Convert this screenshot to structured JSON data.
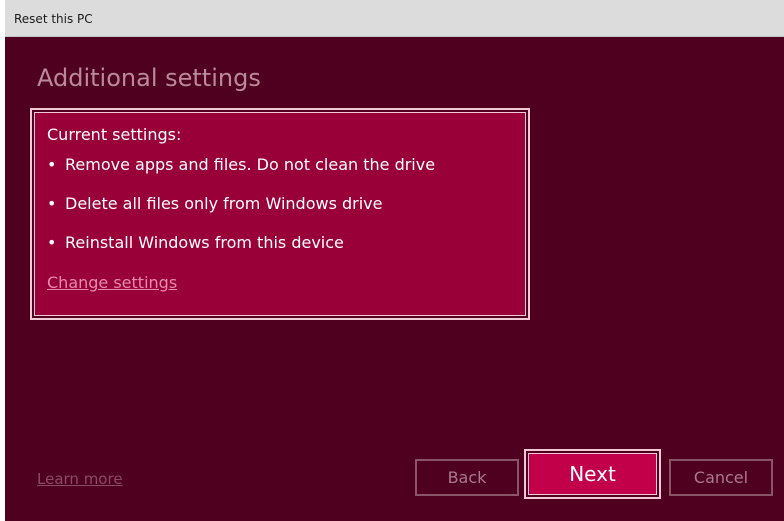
{
  "window": {
    "title": "Reset this PC"
  },
  "main": {
    "heading": "Additional settings",
    "settings_label": "Current settings:",
    "bullets": [
      "Remove apps and files. Do not clean the drive",
      "Delete all files only from Windows drive",
      "Reinstall Windows from this device"
    ],
    "bullet_glyph": "•",
    "change_settings": "Change settings"
  },
  "footer": {
    "learn_more": "Learn more",
    "back_label": "Back",
    "next_label": "Next",
    "cancel_label": "Cancel"
  },
  "colors": {
    "background": "#4f001f",
    "accent": "#c2004a",
    "panel": "#990038",
    "border_highlight": "#f0c8d6"
  }
}
